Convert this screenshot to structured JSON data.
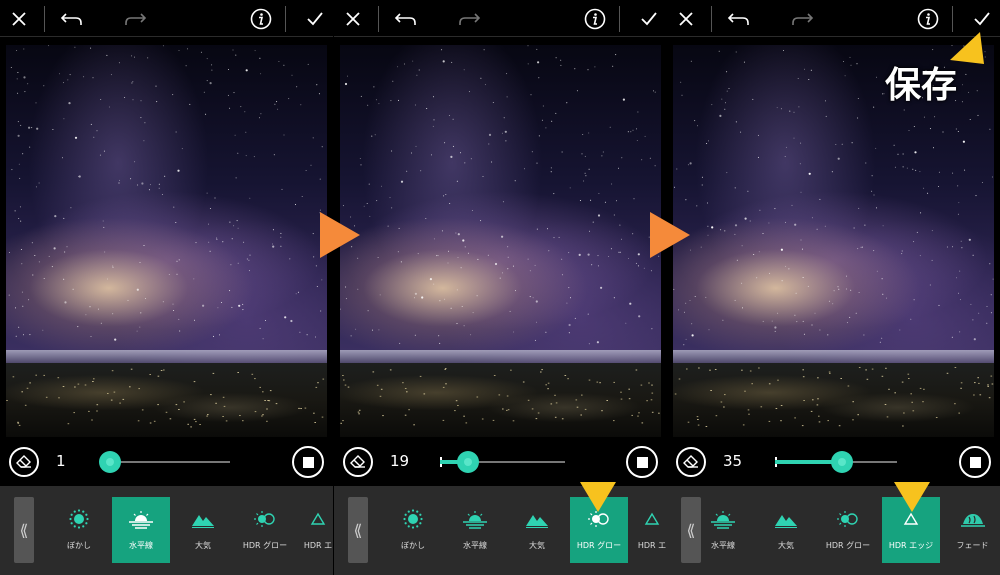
{
  "panels": [
    {
      "slider_value": "1",
      "slider_fraction": 0.0,
      "tools": [
        {
          "label": "ぼかし",
          "icon": "soft-glow-icon",
          "active": false
        },
        {
          "label": "水平線",
          "icon": "horizon-icon",
          "active": true
        },
        {
          "label": "大気",
          "icon": "mountain-icon",
          "active": false
        },
        {
          "label": "HDR グロー",
          "icon": "hdr-glow-icon",
          "active": false
        },
        {
          "label": "HDR エ",
          "icon": "triangle-icon",
          "active": false
        }
      ]
    },
    {
      "slider_value": "19",
      "slider_fraction": 0.22,
      "tools": [
        {
          "label": "ぼかし",
          "icon": "soft-glow-icon",
          "active": false
        },
        {
          "label": "水平線",
          "icon": "horizon-icon",
          "active": false
        },
        {
          "label": "大気",
          "icon": "mountain-icon",
          "active": false
        },
        {
          "label": "HDR グロー",
          "icon": "hdr-glow-icon",
          "active": true
        },
        {
          "label": "HDR エ",
          "icon": "triangle-icon",
          "active": false
        }
      ]
    },
    {
      "slider_value": "35",
      "slider_fraction": 0.55,
      "tools": [
        {
          "label": "水平線",
          "icon": "horizon-icon",
          "active": false
        },
        {
          "label": "大気",
          "icon": "mountain-icon",
          "active": false
        },
        {
          "label": "HDR グロー",
          "icon": "hdr-glow-icon",
          "active": false
        },
        {
          "label": "HDR エッジ",
          "icon": "triangle-icon",
          "active": true
        },
        {
          "label": "フェード",
          "icon": "fade-icon",
          "active": false
        }
      ]
    }
  ],
  "annotation": {
    "save_label": "保存"
  },
  "colors": {
    "accent": "#2fd3b2",
    "active_tool": "#16a37f",
    "next_arrow": "#f58a3a",
    "highlight_arrow": "#f7c21e"
  }
}
